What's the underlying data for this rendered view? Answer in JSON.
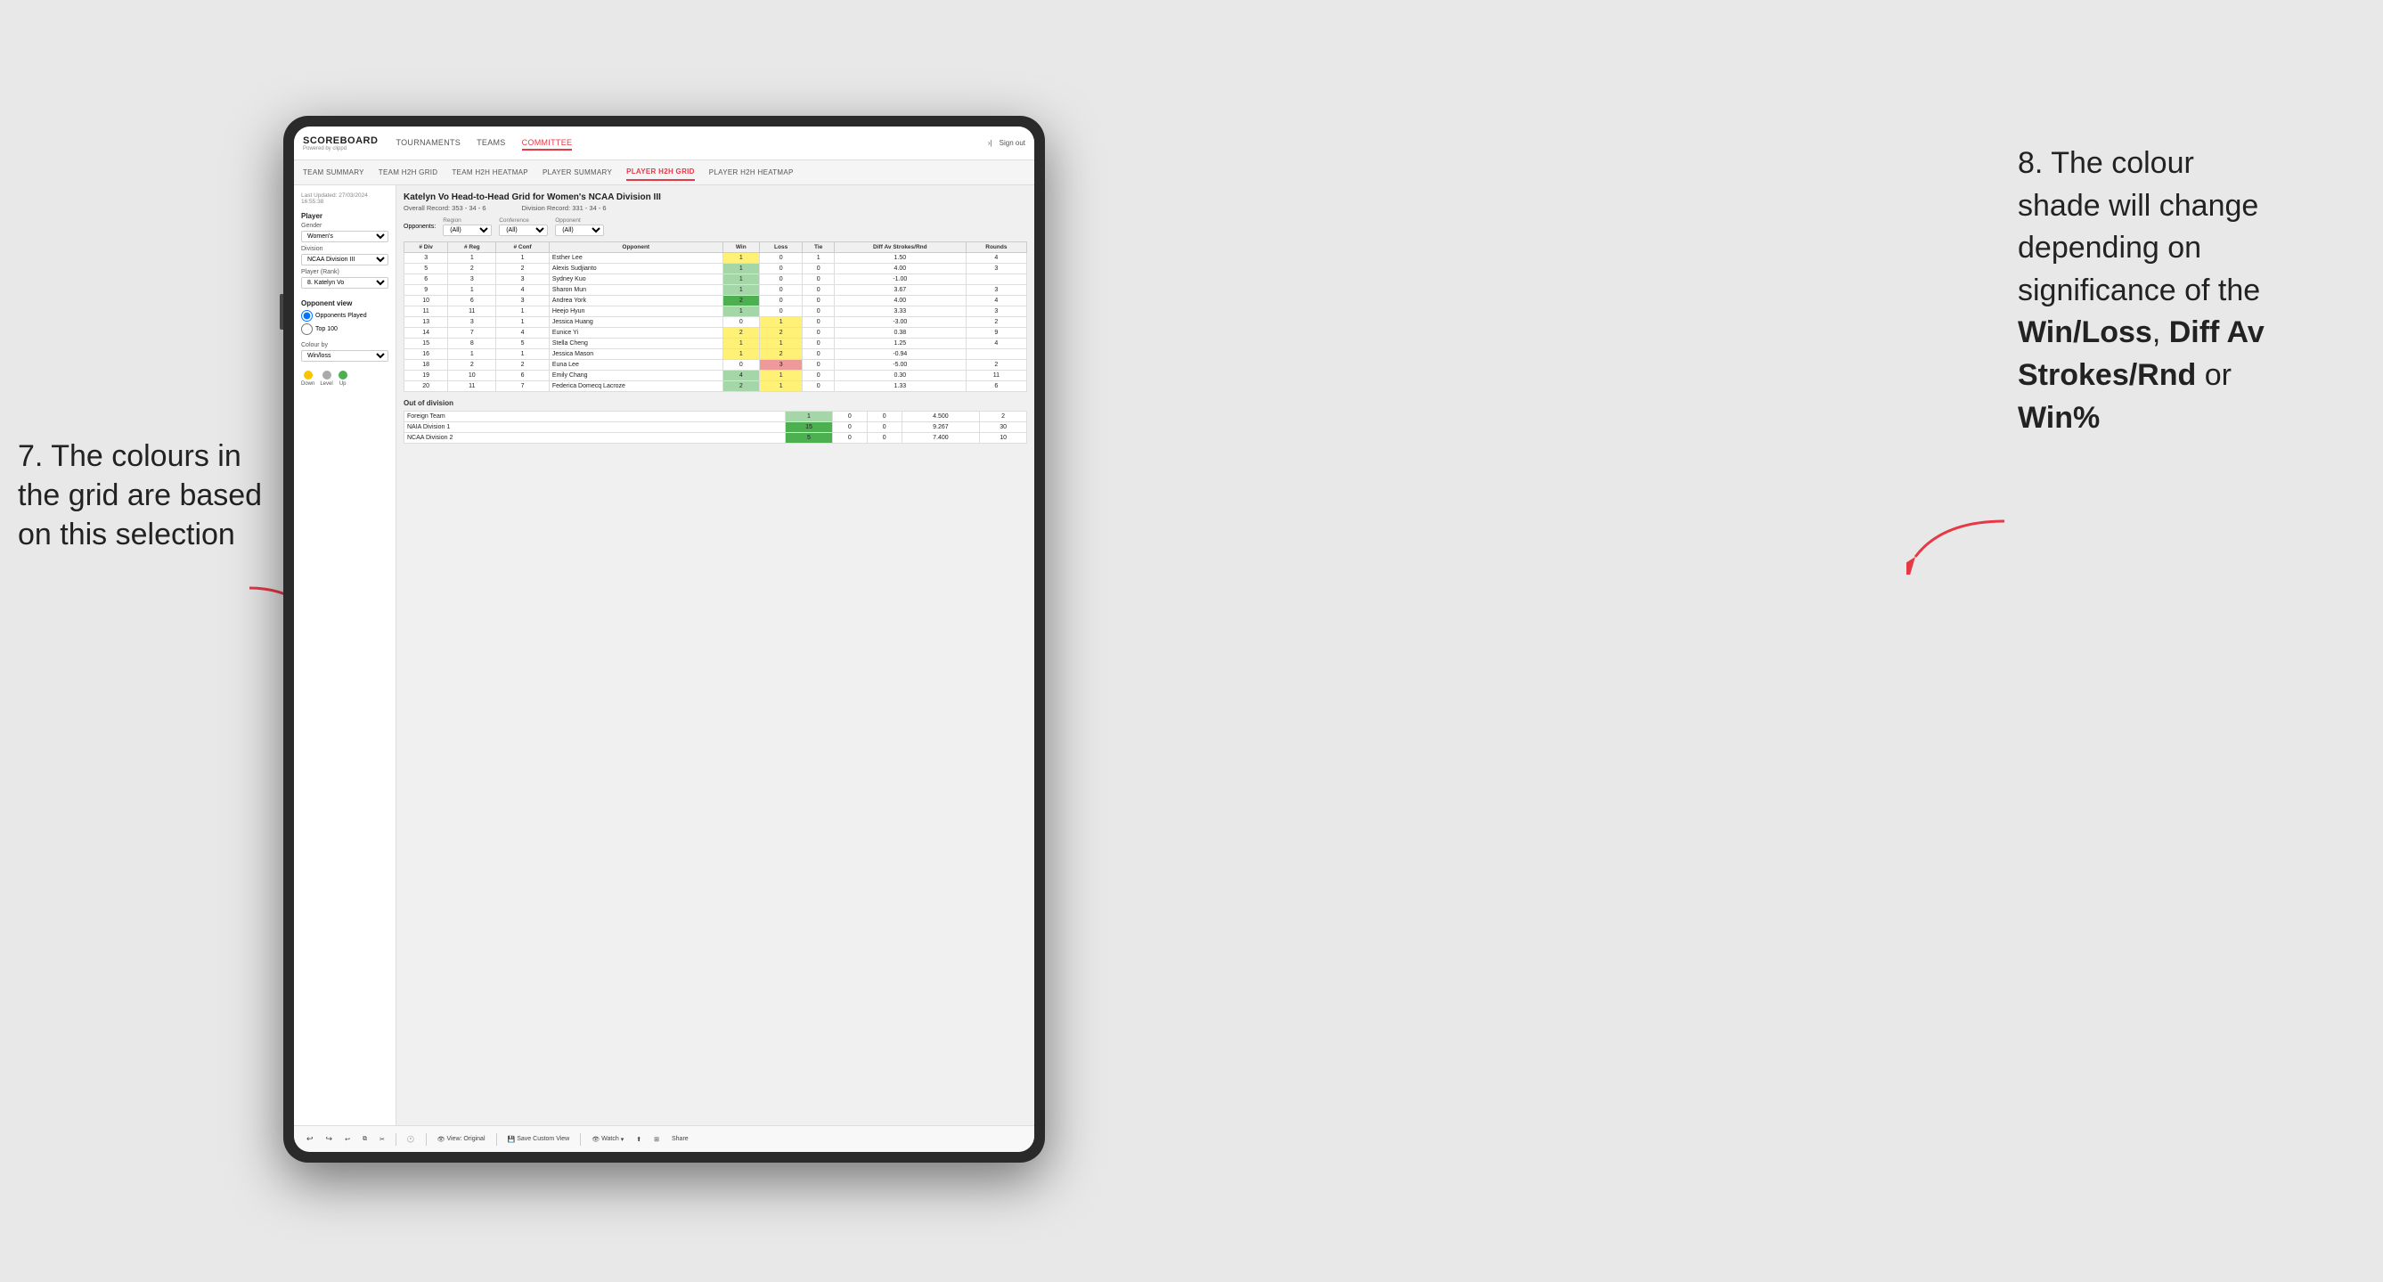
{
  "annotation_left": {
    "line1": "7. The colours in",
    "line2": "the grid are based",
    "line3": "on this selection"
  },
  "annotation_right": {
    "line1": "8. The colour",
    "line2": "shade will change",
    "line3": "depending on",
    "line4": "significance of the",
    "bold1": "Win/Loss",
    "comma": ", ",
    "bold2": "Diff Av",
    "line5": "Strokes/Rnd",
    "line6": " or",
    "bold3": "Win%"
  },
  "nav": {
    "logo": "SCOREBOARD",
    "logo_sub": "Powered by clippd",
    "links": [
      "TOURNAMENTS",
      "TEAMS",
      "COMMITTEE"
    ],
    "active_link": "COMMITTEE",
    "sign_in": "Sign out"
  },
  "sub_nav": {
    "links": [
      "TEAM SUMMARY",
      "TEAM H2H GRID",
      "TEAM H2H HEATMAP",
      "PLAYER SUMMARY",
      "PLAYER H2H GRID",
      "PLAYER H2H HEATMAP"
    ],
    "active": "PLAYER H2H GRID"
  },
  "sidebar": {
    "timestamp": "Last Updated: 27/03/2024 16:55:38",
    "player_section": "Player",
    "gender_label": "Gender",
    "gender_value": "Women's",
    "division_label": "Division",
    "division_value": "NCAA Division III",
    "player_rank_label": "Player (Rank)",
    "player_rank_value": "8. Katelyn Vo",
    "opponent_view_label": "Opponent view",
    "opponents_played": "Opponents Played",
    "top_100": "Top 100",
    "colour_by_label": "Colour by",
    "colour_by_value": "Win/loss",
    "legend_down": "Down",
    "legend_level": "Level",
    "legend_up": "Up"
  },
  "grid": {
    "title": "Katelyn Vo Head-to-Head Grid for Women's NCAA Division III",
    "overall_record": "Overall Record: 353 - 34 - 6",
    "division_record": "Division Record: 331 - 34 - 6",
    "opponents_label": "Opponents:",
    "opponents_value": "(All)",
    "region_label": "Region",
    "region_value": "(All)",
    "conference_label": "Conference",
    "conference_value": "(All)",
    "opponent_label": "Opponent",
    "opponent_value": "(All)",
    "table_headers": [
      "# Div",
      "# Reg",
      "# Conf",
      "Opponent",
      "Win",
      "Loss",
      "Tie",
      "Diff Av Strokes/Rnd",
      "Rounds"
    ],
    "rows": [
      {
        "div": "3",
        "reg": "1",
        "conf": "1",
        "opponent": "Esther Lee",
        "win": 1,
        "loss": 0,
        "tie": 1,
        "diff": "1.50",
        "rounds": 4,
        "win_color": "yellow",
        "loss_color": "",
        "tie_color": ""
      },
      {
        "div": "5",
        "reg": "2",
        "conf": "2",
        "opponent": "Alexis Sudjianto",
        "win": 1,
        "loss": 0,
        "tie": 0,
        "diff": "4.00",
        "rounds": 3,
        "win_color": "green-light",
        "loss_color": "",
        "tie_color": ""
      },
      {
        "div": "6",
        "reg": "3",
        "conf": "3",
        "opponent": "Sydney Kuo",
        "win": 1,
        "loss": 0,
        "tie": 0,
        "diff": "-1.00",
        "rounds": "",
        "win_color": "green-light",
        "loss_color": "",
        "tie_color": ""
      },
      {
        "div": "9",
        "reg": "1",
        "conf": "4",
        "opponent": "Sharon Mun",
        "win": 1,
        "loss": 0,
        "tie": 0,
        "diff": "3.67",
        "rounds": 3,
        "win_color": "green-light",
        "loss_color": "",
        "tie_color": ""
      },
      {
        "div": "10",
        "reg": "6",
        "conf": "3",
        "opponent": "Andrea York",
        "win": 2,
        "loss": 0,
        "tie": 0,
        "diff": "4.00",
        "rounds": 4,
        "win_color": "green-dark",
        "loss_color": "",
        "tie_color": ""
      },
      {
        "div": "11",
        "reg": "11",
        "conf": "1",
        "opponent": "Heejo Hyun",
        "win": 1,
        "loss": 0,
        "tie": 0,
        "diff": "3.33",
        "rounds": 3,
        "win_color": "green-light",
        "loss_color": "",
        "tie_color": ""
      },
      {
        "div": "13",
        "reg": "3",
        "conf": "1",
        "opponent": "Jessica Huang",
        "win": 0,
        "loss": 1,
        "tie": 0,
        "diff": "-3.00",
        "rounds": 2,
        "win_color": "",
        "loss_color": "yellow",
        "tie_color": ""
      },
      {
        "div": "14",
        "reg": "7",
        "conf": "4",
        "opponent": "Eunice Yi",
        "win": 2,
        "loss": 2,
        "tie": 0,
        "diff": "0.38",
        "rounds": 9,
        "win_color": "yellow",
        "loss_color": "yellow",
        "tie_color": ""
      },
      {
        "div": "15",
        "reg": "8",
        "conf": "5",
        "opponent": "Stella Cheng",
        "win": 1,
        "loss": 1,
        "tie": 0,
        "diff": "1.25",
        "rounds": 4,
        "win_color": "yellow",
        "loss_color": "yellow",
        "tie_color": ""
      },
      {
        "div": "16",
        "reg": "1",
        "conf": "1",
        "opponent": "Jessica Mason",
        "win": 1,
        "loss": 2,
        "tie": 0,
        "diff": "-0.94",
        "rounds": "",
        "win_color": "yellow",
        "loss_color": "yellow",
        "tie_color": ""
      },
      {
        "div": "18",
        "reg": "2",
        "conf": "2",
        "opponent": "Euna Lee",
        "win": 0,
        "loss": 3,
        "tie": 0,
        "diff": "-5.00",
        "rounds": 2,
        "win_color": "",
        "loss_color": "red",
        "tie_color": ""
      },
      {
        "div": "19",
        "reg": "10",
        "conf": "6",
        "opponent": "Emily Chang",
        "win": 4,
        "loss": 1,
        "tie": 0,
        "diff": "0.30",
        "rounds": 11,
        "win_color": "green-light",
        "loss_color": "yellow",
        "tie_color": ""
      },
      {
        "div": "20",
        "reg": "11",
        "conf": "7",
        "opponent": "Federica Domecq Lacroze",
        "win": 2,
        "loss": 1,
        "tie": 0,
        "diff": "1.33",
        "rounds": 6,
        "win_color": "green-light",
        "loss_color": "yellow",
        "tie_color": ""
      }
    ],
    "out_of_division_label": "Out of division",
    "out_of_division_rows": [
      {
        "opponent": "Foreign Team",
        "win": 1,
        "loss": 0,
        "tie": 0,
        "diff": "4.500",
        "rounds": 2,
        "win_color": "green-light"
      },
      {
        "opponent": "NAIA Division 1",
        "win": 15,
        "loss": 0,
        "tie": 0,
        "diff": "9.267",
        "rounds": 30,
        "win_color": "green-dark"
      },
      {
        "opponent": "NCAA Division 2",
        "win": 5,
        "loss": 0,
        "tie": 0,
        "diff": "7.400",
        "rounds": 10,
        "win_color": "green-dark"
      }
    ]
  },
  "toolbar": {
    "view_original": "View: Original",
    "save_custom": "Save Custom View",
    "watch": "Watch",
    "share": "Share"
  }
}
